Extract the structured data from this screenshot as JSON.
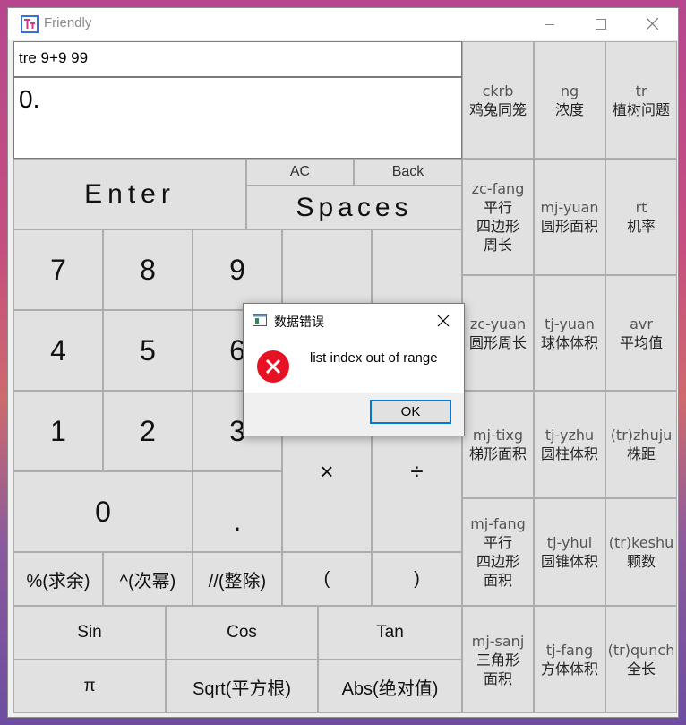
{
  "window": {
    "title": "Friendly"
  },
  "display": {
    "input_value": "tre 9+9 99",
    "output_value": "0."
  },
  "controls": {
    "enter": "Enter",
    "spaces": "Spaces",
    "ac": "AC",
    "back": "Back"
  },
  "keypad": {
    "seven": "7",
    "eight": "8",
    "nine": "9",
    "four": "4",
    "five": "5",
    "six": "6",
    "one": "1",
    "two": "2",
    "three": "3",
    "zero": "0",
    "dot": ".",
    "multiply": "×",
    "divide": "÷",
    "mod": "%(求余)",
    "power": "^(次幂)",
    "floor_div": "//(整除)",
    "lparen": "(",
    "rparen": ")",
    "sin": "Sin",
    "cos": "Cos",
    "tan": "Tan",
    "pi": "π",
    "sqrt": "Sqrt(平方根)",
    "abs": "Abs(绝对值)"
  },
  "side_buttons": [
    {
      "id": "ckrb",
      "lines": [
        "ckrb",
        "鸡兔同笼"
      ]
    },
    {
      "id": "ng",
      "lines": [
        "ng",
        "浓度"
      ]
    },
    {
      "id": "tr",
      "lines": [
        "tr",
        "植树问题"
      ]
    },
    {
      "id": "zc-fang",
      "lines": [
        "zc-fang",
        "平行",
        "四边形",
        "周长"
      ]
    },
    {
      "id": "mj-yuan",
      "lines": [
        "mj-yuan",
        "圆形面积"
      ]
    },
    {
      "id": "rt",
      "lines": [
        "rt",
        "机率"
      ]
    },
    {
      "id": "zc-yuan",
      "lines": [
        "zc-yuan",
        "圆形周长"
      ]
    },
    {
      "id": "tj-yuan",
      "lines": [
        "tj-yuan",
        "球体体积"
      ]
    },
    {
      "id": "avr",
      "lines": [
        "avr",
        "平均值"
      ]
    },
    {
      "id": "mj-tixg",
      "lines": [
        "mj-tixg",
        "梯形面积"
      ]
    },
    {
      "id": "tj-yzhu",
      "lines": [
        "tj-yzhu",
        "圆柱体积"
      ]
    },
    {
      "id": "zhuju",
      "lines": [
        "(tr)zhuju",
        "株距"
      ]
    },
    {
      "id": "mj-fang",
      "lines": [
        "mj-fang",
        "平行",
        "四边形",
        "面积"
      ]
    },
    {
      "id": "tj-yhui",
      "lines": [
        "tj-yhui",
        "圆锥体积"
      ]
    },
    {
      "id": "keshu",
      "lines": [
        "(tr)keshu",
        "颗数"
      ]
    },
    {
      "id": "mj-sanj",
      "lines": [
        "mj-sanj",
        "三角形",
        "面积"
      ]
    },
    {
      "id": "tj-fang",
      "lines": [
        "tj-fang",
        "方体体积"
      ]
    },
    {
      "id": "qunch",
      "lines": [
        "(tr)qunch",
        "全长"
      ]
    }
  ],
  "dialog": {
    "title": "数据错误",
    "message": "list index out of range",
    "ok": "OK"
  },
  "icons": {
    "app": "calculator-app-icon",
    "error": "error-x-icon",
    "dialog": "dialog-window-icon",
    "close": "close-icon"
  },
  "colors": {
    "error_red": "#e81123",
    "focus_blue": "#0078d7"
  }
}
